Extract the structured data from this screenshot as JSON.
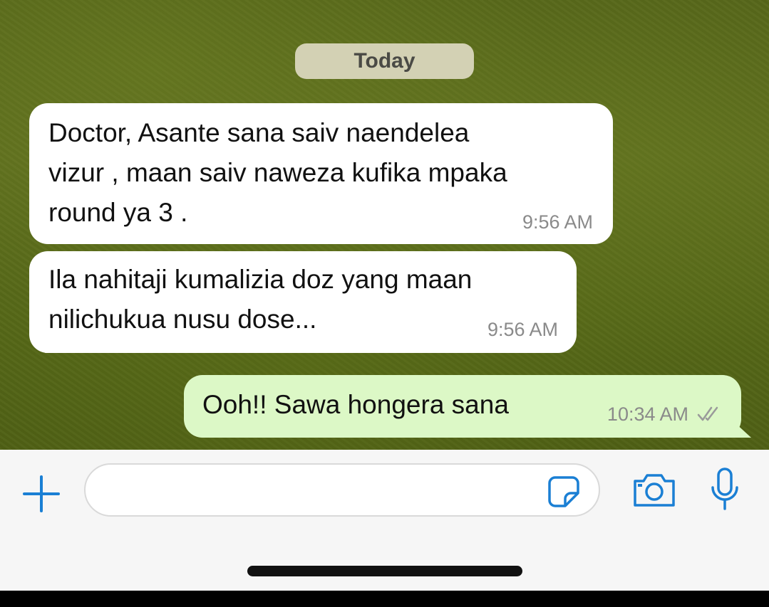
{
  "chat": {
    "date_separator": "Today",
    "messages": [
      {
        "direction": "incoming",
        "text": "Doctor, Asante sana saiv naendelea\nvizur , maan saiv naweza kufika mpaka\nround ya 3 .",
        "time": "9:56 AM"
      },
      {
        "direction": "incoming",
        "text": "Ila nahitaji kumalizia doz yang maan\nnilichukua nusu dose...",
        "time": "9:56 AM"
      },
      {
        "direction": "outgoing",
        "text": "Ooh!! Sawa hongera sana",
        "time": "10:34 AM",
        "status_icon": "double-check-icon"
      }
    ]
  },
  "input_bar": {
    "message_value": "",
    "icons": [
      "plus-icon",
      "sticker-icon",
      "camera-icon",
      "microphone-icon"
    ]
  },
  "colors": {
    "incoming_bubble": "#ffffff",
    "outgoing_bubble": "#dcf8c6",
    "accent_blue": "#1a7fd4",
    "timestamp": "#8a8a8a",
    "wallpaper": "#5a6a1c"
  }
}
